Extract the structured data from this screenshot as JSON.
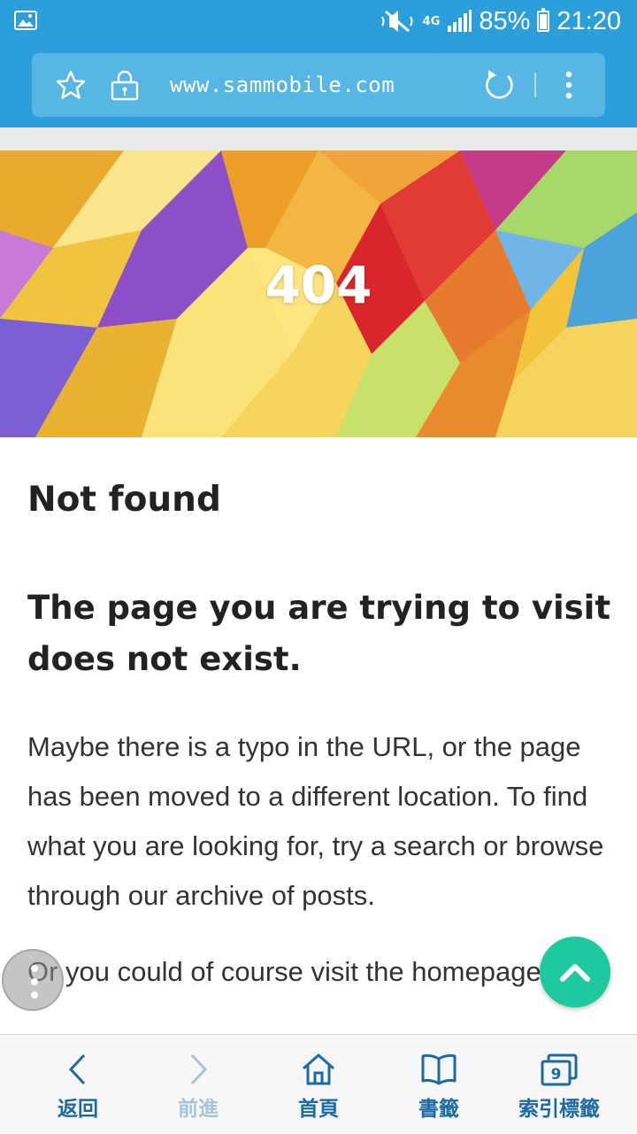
{
  "status_bar": {
    "network": "4G",
    "battery": "85%",
    "time": "21:20",
    "icons": [
      "gallery-icon",
      "mute-icon",
      "signal-icon",
      "battery-icon"
    ]
  },
  "browser": {
    "url": "www.sammobile.com",
    "icons": [
      "star-icon",
      "lock-icon",
      "reload-icon",
      "more-icon"
    ]
  },
  "hero": {
    "code": "404"
  },
  "article": {
    "title": "Not found",
    "heading": "The page you are trying to visit does not exist.",
    "paragraph1": "Maybe there is a typo in the URL, or the page has been moved to a different location. To find what you are looking for, try a search or browse through our archive of posts.",
    "paragraph2": "Or you could of course visit the homepage"
  },
  "floating": {
    "assist_icon": "vertical-dots-icon",
    "top_icon": "chevron-up-icon",
    "top_color": "#1fc9a0"
  },
  "bottom_nav": {
    "items": [
      {
        "label": "返回",
        "icon": "back-icon",
        "enabled": true
      },
      {
        "label": "前進",
        "icon": "forward-icon",
        "enabled": false
      },
      {
        "label": "首頁",
        "icon": "home-icon",
        "enabled": true
      },
      {
        "label": "書籤",
        "icon": "bookmarks-icon",
        "enabled": true
      },
      {
        "label": "索引標籤",
        "icon": "tabs-icon",
        "enabled": true,
        "badge": "9"
      }
    ]
  },
  "colors": {
    "chrome": "#2c9ed9",
    "nav_text": "#1b6aa4",
    "nav_disabled": "#a9c3d8"
  }
}
